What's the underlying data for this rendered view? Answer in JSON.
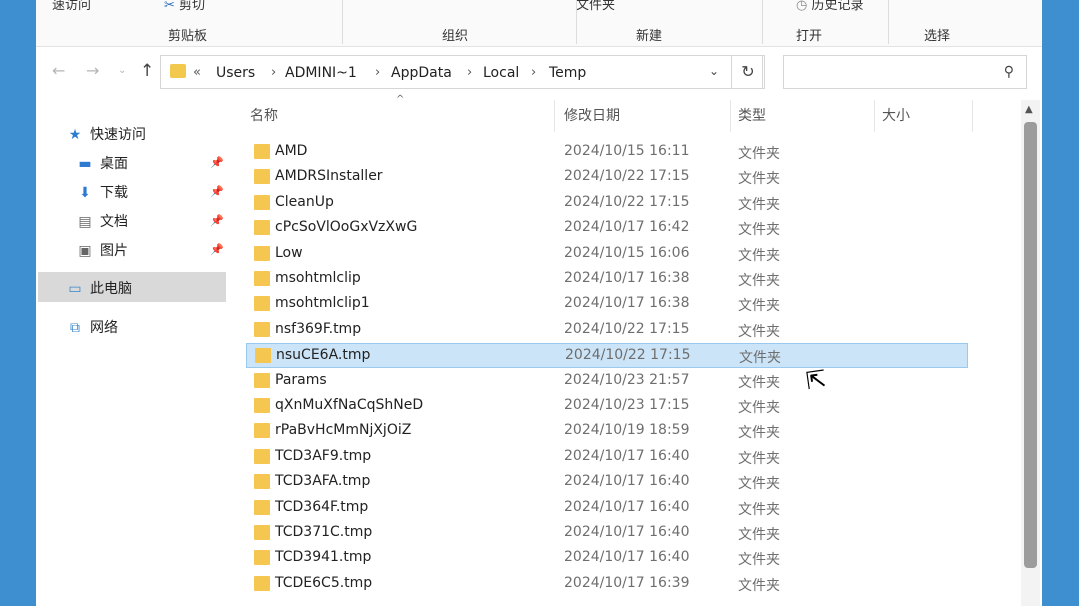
{
  "ribbon": {
    "top_fragments": [
      "速访问",
      "剪切",
      "文件夹",
      "历史记录"
    ],
    "groups": [
      "剪贴板",
      "组织",
      "新建",
      "打开",
      "选择"
    ]
  },
  "address": {
    "prefix": "«",
    "crumbs": [
      "Users",
      "ADMINI~1",
      "AppData",
      "Local",
      "Temp"
    ],
    "search_placeholder": ""
  },
  "nav": {
    "quick_access": "快速访问",
    "desktop": "桌面",
    "downloads": "下载",
    "documents": "文档",
    "pictures": "图片",
    "this_pc": "此电脑",
    "network": "网络"
  },
  "columns": {
    "name": "名称",
    "date": "修改日期",
    "type": "类型",
    "size": "大小"
  },
  "files": [
    {
      "name": "AMD",
      "date": "2024/10/15 16:11",
      "type": "文件夹"
    },
    {
      "name": "AMDRSInstaller",
      "date": "2024/10/22 17:15",
      "type": "文件夹"
    },
    {
      "name": "CleanUp",
      "date": "2024/10/22 17:15",
      "type": "文件夹"
    },
    {
      "name": "cPcSoVlOoGxVzXwG",
      "date": "2024/10/17 16:42",
      "type": "文件夹"
    },
    {
      "name": "Low",
      "date": "2024/10/15 16:06",
      "type": "文件夹"
    },
    {
      "name": "msohtmlclip",
      "date": "2024/10/17 16:38",
      "type": "文件夹"
    },
    {
      "name": "msohtmlclip1",
      "date": "2024/10/17 16:38",
      "type": "文件夹"
    },
    {
      "name": "nsf369F.tmp",
      "date": "2024/10/22 17:15",
      "type": "文件夹"
    },
    {
      "name": "nsuCE6A.tmp",
      "date": "2024/10/22 17:15",
      "type": "文件夹",
      "selected": true
    },
    {
      "name": "Params",
      "date": "2024/10/23 21:57",
      "type": "文件夹"
    },
    {
      "name": "qXnMuXfNaCqShNeD",
      "date": "2024/10/23 17:15",
      "type": "文件夹"
    },
    {
      "name": "rPaBvHcMmNjXjOiZ",
      "date": "2024/10/19 18:59",
      "type": "文件夹"
    },
    {
      "name": "TCD3AF9.tmp",
      "date": "2024/10/17 16:40",
      "type": "文件夹"
    },
    {
      "name": "TCD3AFA.tmp",
      "date": "2024/10/17 16:40",
      "type": "文件夹"
    },
    {
      "name": "TCD364F.tmp",
      "date": "2024/10/17 16:40",
      "type": "文件夹"
    },
    {
      "name": "TCD371C.tmp",
      "date": "2024/10/17 16:40",
      "type": "文件夹"
    },
    {
      "name": "TCD3941.tmp",
      "date": "2024/10/17 16:40",
      "type": "文件夹"
    },
    {
      "name": "TCDE6C5.tmp",
      "date": "2024/10/17 16:39",
      "type": "文件夹"
    }
  ],
  "colors": {
    "selection": "#cce4f7",
    "folder": "#f5c750",
    "desktop_bg": "#3e8fcf"
  }
}
